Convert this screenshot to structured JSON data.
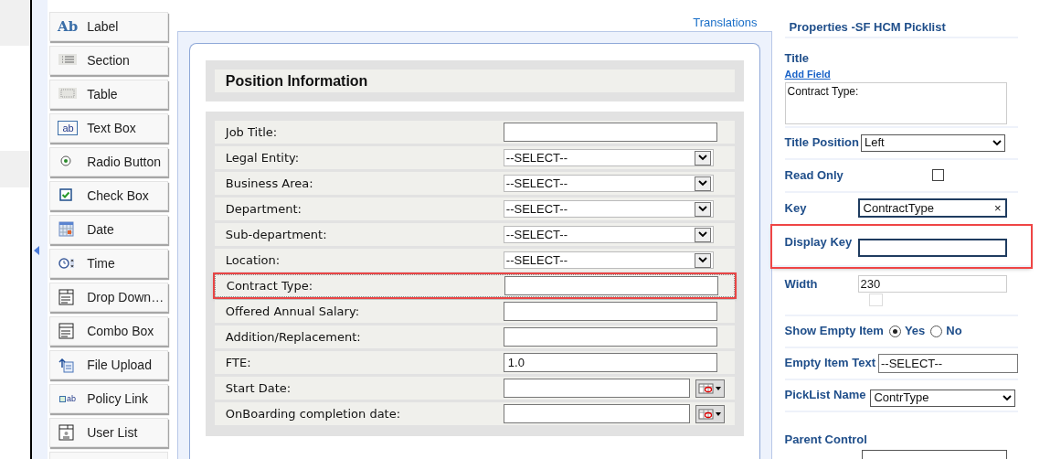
{
  "toolbox": [
    {
      "label": "Label",
      "glyph": "Ab"
    },
    {
      "label": "Section"
    },
    {
      "label": "Table"
    },
    {
      "label": "Text Box",
      "glyph": "ab"
    },
    {
      "label": "Radio Button"
    },
    {
      "label": "Check Box"
    },
    {
      "label": "Date"
    },
    {
      "label": "Time"
    },
    {
      "label": "Drop Down…"
    },
    {
      "label": "Combo Box"
    },
    {
      "label": "File Upload"
    },
    {
      "label": "Policy Link",
      "glyph": "ab"
    },
    {
      "label": "User List"
    }
  ],
  "translations_link": "Translations",
  "form": {
    "section_title": "Position Information",
    "rows": [
      {
        "label": "Job Title:",
        "kind": "text",
        "highlighted": false
      },
      {
        "label": "Legal Entity:",
        "kind": "select",
        "value": "--SELECT--",
        "highlighted": false
      },
      {
        "label": "Business Area:",
        "kind": "select",
        "value": "--SELECT--",
        "highlighted": false
      },
      {
        "label": "Department:",
        "kind": "select",
        "value": "--SELECT--",
        "highlighted": false
      },
      {
        "label": "Sub-department:",
        "kind": "select",
        "value": "--SELECT--",
        "highlighted": false
      },
      {
        "label": "Location:",
        "kind": "select",
        "value": "--SELECT--",
        "highlighted": false
      },
      {
        "label": "Contract Type:",
        "kind": "text",
        "highlighted": true
      },
      {
        "label": "Offered Annual Salary:",
        "kind": "text",
        "highlighted": false
      },
      {
        "label": "Addition/Replacement:",
        "kind": "text",
        "highlighted": false
      },
      {
        "label": "FTE:",
        "kind": "text",
        "value": "1.0",
        "highlighted": false
      },
      {
        "label": "Start Date:",
        "kind": "date",
        "highlighted": false
      },
      {
        "label": "OnBoarding completion date:",
        "kind": "date",
        "highlighted": false
      }
    ]
  },
  "properties": {
    "title": "Properties -SF HCM Picklist",
    "items": [
      {
        "label": "Title",
        "kind": "textarea",
        "link": "Add Field",
        "value": "Contract Type:",
        "highlighted": false
      },
      {
        "label": "Title Position",
        "kind": "select",
        "value": "Left",
        "highlighted": false
      },
      {
        "label": "Read Only",
        "kind": "checkbox",
        "checked": false,
        "highlighted": false
      },
      {
        "label": "Key",
        "kind": "clearable",
        "value": "ContractType",
        "clear": "×",
        "highlighted": false
      },
      {
        "label": "Display Key",
        "kind": "focused",
        "highlighted": true
      },
      {
        "label": "Width",
        "kind": "width",
        "value": "230",
        "checked": false,
        "highlighted": false
      },
      {
        "label": "Show Empty Item",
        "kind": "radio",
        "options": [
          {
            "label": "Yes",
            "selected": true
          },
          {
            "label": "No",
            "selected": false
          }
        ],
        "highlighted": false
      },
      {
        "label": "Empty Item Text",
        "kind": "input",
        "value": "--SELECT--",
        "highlighted": false
      },
      {
        "label": "PickList Name",
        "kind": "select",
        "value": "ContrType",
        "highlighted": false
      },
      {
        "label": "Parent Control",
        "kind": "select_below"
      }
    ]
  }
}
